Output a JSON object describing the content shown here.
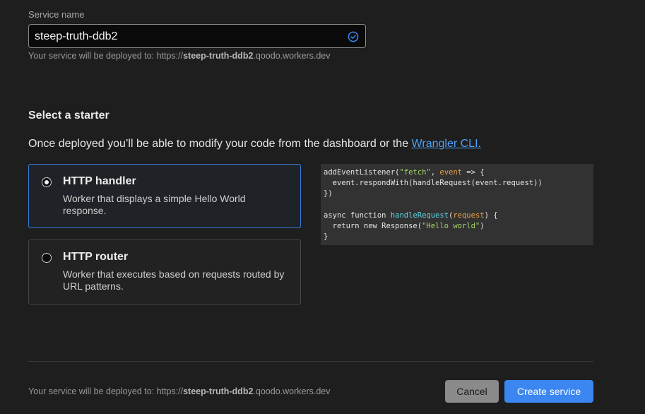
{
  "service_name": {
    "label": "Service name",
    "value": "steep-truth-ddb2",
    "valid_icon": "check-circle-icon",
    "deploy_prefix": "Your service will be deployed to: https://",
    "deploy_name": "steep-truth-ddb2",
    "deploy_suffix": ".qoodo.workers.dev"
  },
  "starter": {
    "title": "Select a starter",
    "intro_text": "Once deployed you’ll be able to modify your code from the dashboard or the ",
    "intro_link": "Wrangler CLI.",
    "options": [
      {
        "title": "HTTP handler",
        "description": "Worker that displays a simple Hello World response.",
        "selected": true
      },
      {
        "title": "HTTP router",
        "description": "Worker that executes based on requests routed by URL patterns.",
        "selected": false
      }
    ],
    "code_lines": [
      "addEventListener(\"fetch\", event => {",
      "  event.respondWith(handleRequest(event.request))",
      "})",
      "",
      "async function handleRequest(request) {",
      "  return new Response(\"Hello world\")",
      "}"
    ]
  },
  "footer": {
    "deploy_prefix": "Your service will be deployed to: https://",
    "deploy_name": "steep-truth-ddb2",
    "deploy_suffix": ".qoodo.workers.dev",
    "cancel_label": "Cancel",
    "create_label": "Create service"
  },
  "colors": {
    "accent": "#3b86f0",
    "link": "#4ea1f7",
    "background": "#1e1e1e"
  }
}
